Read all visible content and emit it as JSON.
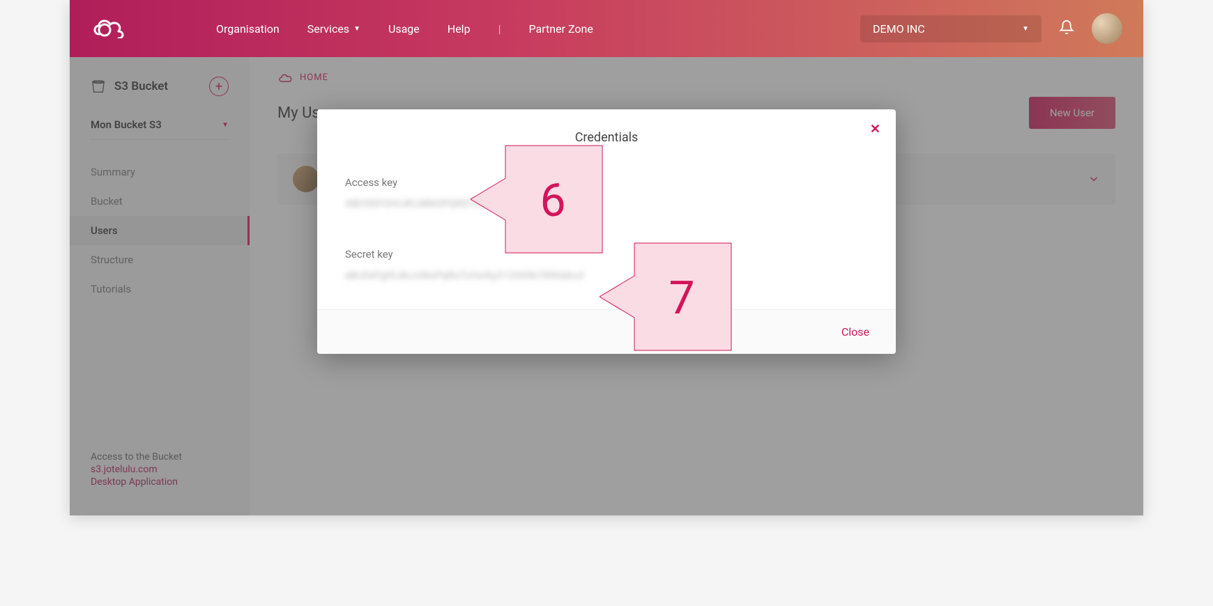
{
  "topbar": {
    "nav": {
      "organisation": "Organisation",
      "services": "Services",
      "usage": "Usage",
      "help": "Help",
      "partner_zone": "Partner Zone"
    },
    "org_selected": "DEMO INC"
  },
  "sidebar": {
    "title": "S3 Bucket",
    "bucket_selected": "Mon Bucket S3",
    "menu": {
      "summary": "Summary",
      "bucket": "Bucket",
      "users": "Users",
      "structure": "Structure",
      "tutorials": "Tutorials"
    },
    "footer": {
      "access_label": "Access to the Bucket",
      "s3_url": "s3.jotelulu.com",
      "desktop_app": "Desktop Application"
    }
  },
  "main": {
    "breadcrumb_home": "HOME",
    "page_title": "My Users",
    "new_user_btn": "New User"
  },
  "modal": {
    "title": "Credentials",
    "access_key_label": "Access key",
    "access_key_value": "ABCDEFGHIJKLMNOPQRSTUVWX",
    "secret_key_label": "Secret key",
    "secret_key_value": "aBcDeFgHiJkLmNoPqRsTuVwXyZ1234567890abcd",
    "close_btn": "Close"
  },
  "callouts": {
    "six": "6",
    "seven": "7"
  }
}
